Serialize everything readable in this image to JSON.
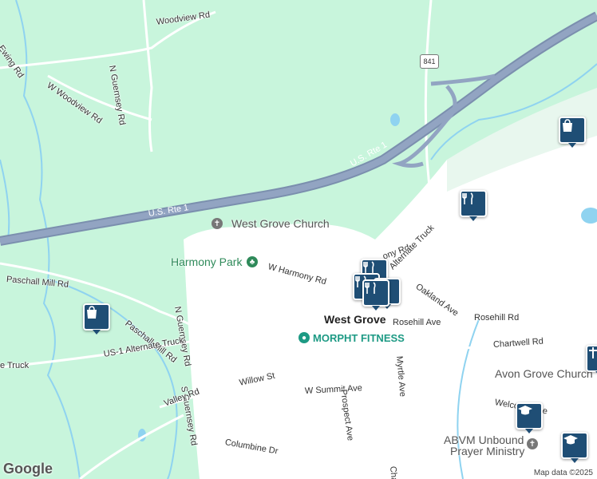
{
  "map": {
    "place": "West Grove",
    "roads": {
      "woodview_rd": "Woodview Rd",
      "ewing_rd": "Ewing Rd",
      "n_guernsey_rd_top": "N Guernsey Rd",
      "w_woodview_rd": "W Woodview Rd",
      "us_rte_1_left": "U.S. Rte 1",
      "us_rte_1_right": "U.S. Rte 1",
      "paschall_mill_rd_left": "Paschall Mill Rd",
      "paschall_mill_rd_right": "Paschall Mill Rd",
      "n_guernsey_rd_mid": "N Guernsey Rd",
      "s_guernsey_rd": "S Guernsey Rd",
      "w_harmony_rd": "W Harmony Rd",
      "harmony_rd": "ony Rd",
      "alternate_truck_right": "Alternate Truck",
      "oakland_ave": "Oakland Ave",
      "rosehill_ave": "Rosehill Ave",
      "rosehill_rd": "Rosehill Rd",
      "chartwell_rd": "Chartwell Rd",
      "us1_alt_truck": "US-1 Alternate Truck",
      "truck_left": "e Truck",
      "myrtle_ave": "Myrtle Ave",
      "willow_st": "Willow St",
      "w_summit_ave": "W Summit Ave",
      "prospect_ave": "Prospect Ave",
      "valley_rd": "Valley Rd",
      "columbine_dr": "Columbine Dr",
      "welcome_ave": "Welcome Ave",
      "chamb": "Chamb",
      "route_841": "841"
    },
    "pois": {
      "west_grove_church": "West Grove Church",
      "harmony_park": "Harmony Park",
      "morpht_fitness": "MORPHT FITNESS",
      "avon_grove_church": "Avon Grove Church",
      "abvm_line1": "ABVM Unbound",
      "abvm_line2": "Prayer Ministry"
    },
    "attribution": "Map data ©2025",
    "logo": "Google",
    "colors": {
      "land": "#c8f5dc",
      "town": "#ffffff",
      "highway": "#8a9cb8",
      "stream": "#8fd3f0",
      "pin": "#1f4e75"
    }
  }
}
